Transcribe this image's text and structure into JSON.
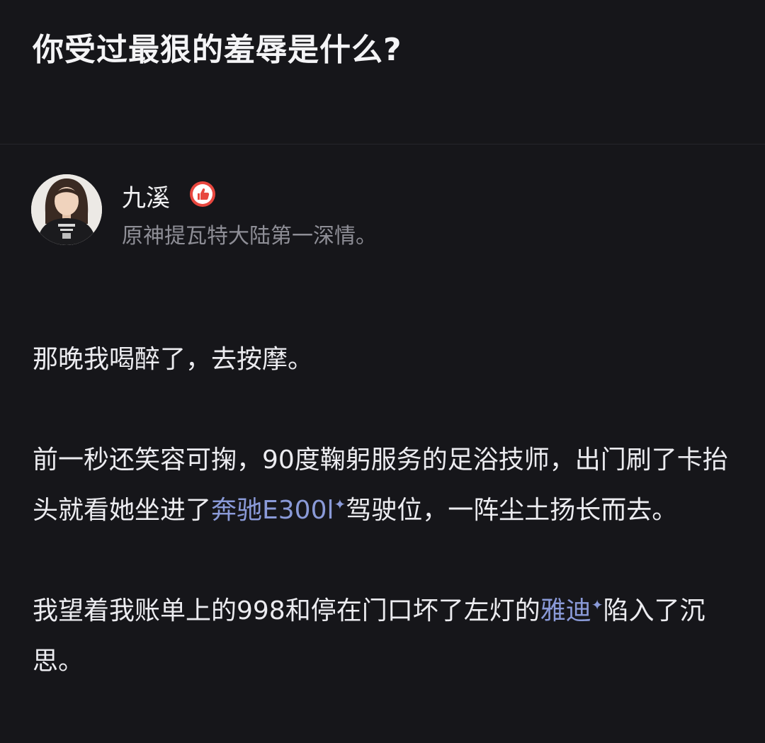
{
  "question": {
    "title": "你受过最狠的羞辱是什么?"
  },
  "author": {
    "name": "九溪",
    "badge_icon": "thumbs-up-badge-icon",
    "bio": "原神提瓦特大陆第一深情。"
  },
  "answer": {
    "paragraphs": [
      {
        "text": "那晚我喝醉了，去按摩。"
      },
      {
        "text_1": "前一秒还笑容可掬，90度鞠躬服务的足浴技师，出门刷了卡抬头就看她坐进了",
        "link": "奔驰E300l",
        "text_2": "驾驶位，一阵尘土扬长而去。"
      },
      {
        "text_1": "我望着我账单上的998和停在门口坏了左灯的",
        "link": "雅迪",
        "text_2": "陷入了沉思。"
      }
    ],
    "spark_glyph": "✦"
  },
  "colors": {
    "background": "#16161a",
    "text": "#ececf0",
    "bio": "#8e8e96",
    "link": "#8a9ad8",
    "badge": "#e8473f"
  }
}
